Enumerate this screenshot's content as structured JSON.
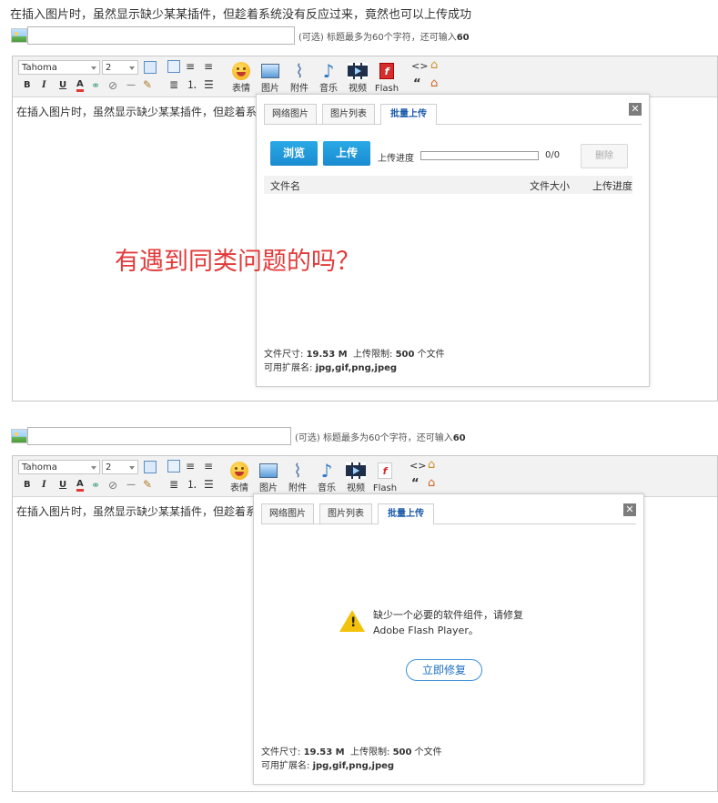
{
  "top_text": "在插入图片时，虽然显示缺少某某插件，但趁着系统没有反应过来，竟然也可以上传成功",
  "overlay_question": "有遇到同类问题的吗？",
  "title_hint_prefix": "(可选) 标题最多为60个字符，还可输入",
  "title_hint_count": "60",
  "toolbar": {
    "font_name": "Tahoma",
    "font_size": "2",
    "fmt_bold": "B",
    "fmt_italic": "I",
    "fmt_underline": "U",
    "fmt_color": "A",
    "fmt_hr": "—",
    "code_glyph": "<>",
    "quote_glyph": "“",
    "emoji_label": "表情",
    "image_label": "图片",
    "attach_label": "附件",
    "music_label": "音乐",
    "video_label": "视频",
    "flash_label": "Flash",
    "flash_glyph": "f"
  },
  "editor_text": "在插入图片时，虽然显示缺少某某插件，但趁着系",
  "dialog": {
    "tabs": [
      "网络图片",
      "图片列表",
      "批量上传"
    ],
    "close": "✕",
    "browse": "浏览",
    "upload": "上传",
    "progress_label": "上传进度",
    "progress_count": "0/0",
    "delete": "删除",
    "col_filename": "文件名",
    "col_filesize": "文件大小",
    "col_progress": "上传进度",
    "footer_size_label": "文件尺寸:",
    "footer_size_value": "19.53 M",
    "footer_limit_label": "上传限制:",
    "footer_limit_value": "500",
    "footer_limit_unit": "个文件",
    "footer_ext_label": "可用扩展名:",
    "footer_ext_value": "jpg,gif,png,jpeg"
  },
  "flash_warning": {
    "line1": "缺少一个必要的软件组件，请修复",
    "line2": "Adobe Flash Player。",
    "repair_button": "立即修复",
    "warn_glyph": "!"
  }
}
